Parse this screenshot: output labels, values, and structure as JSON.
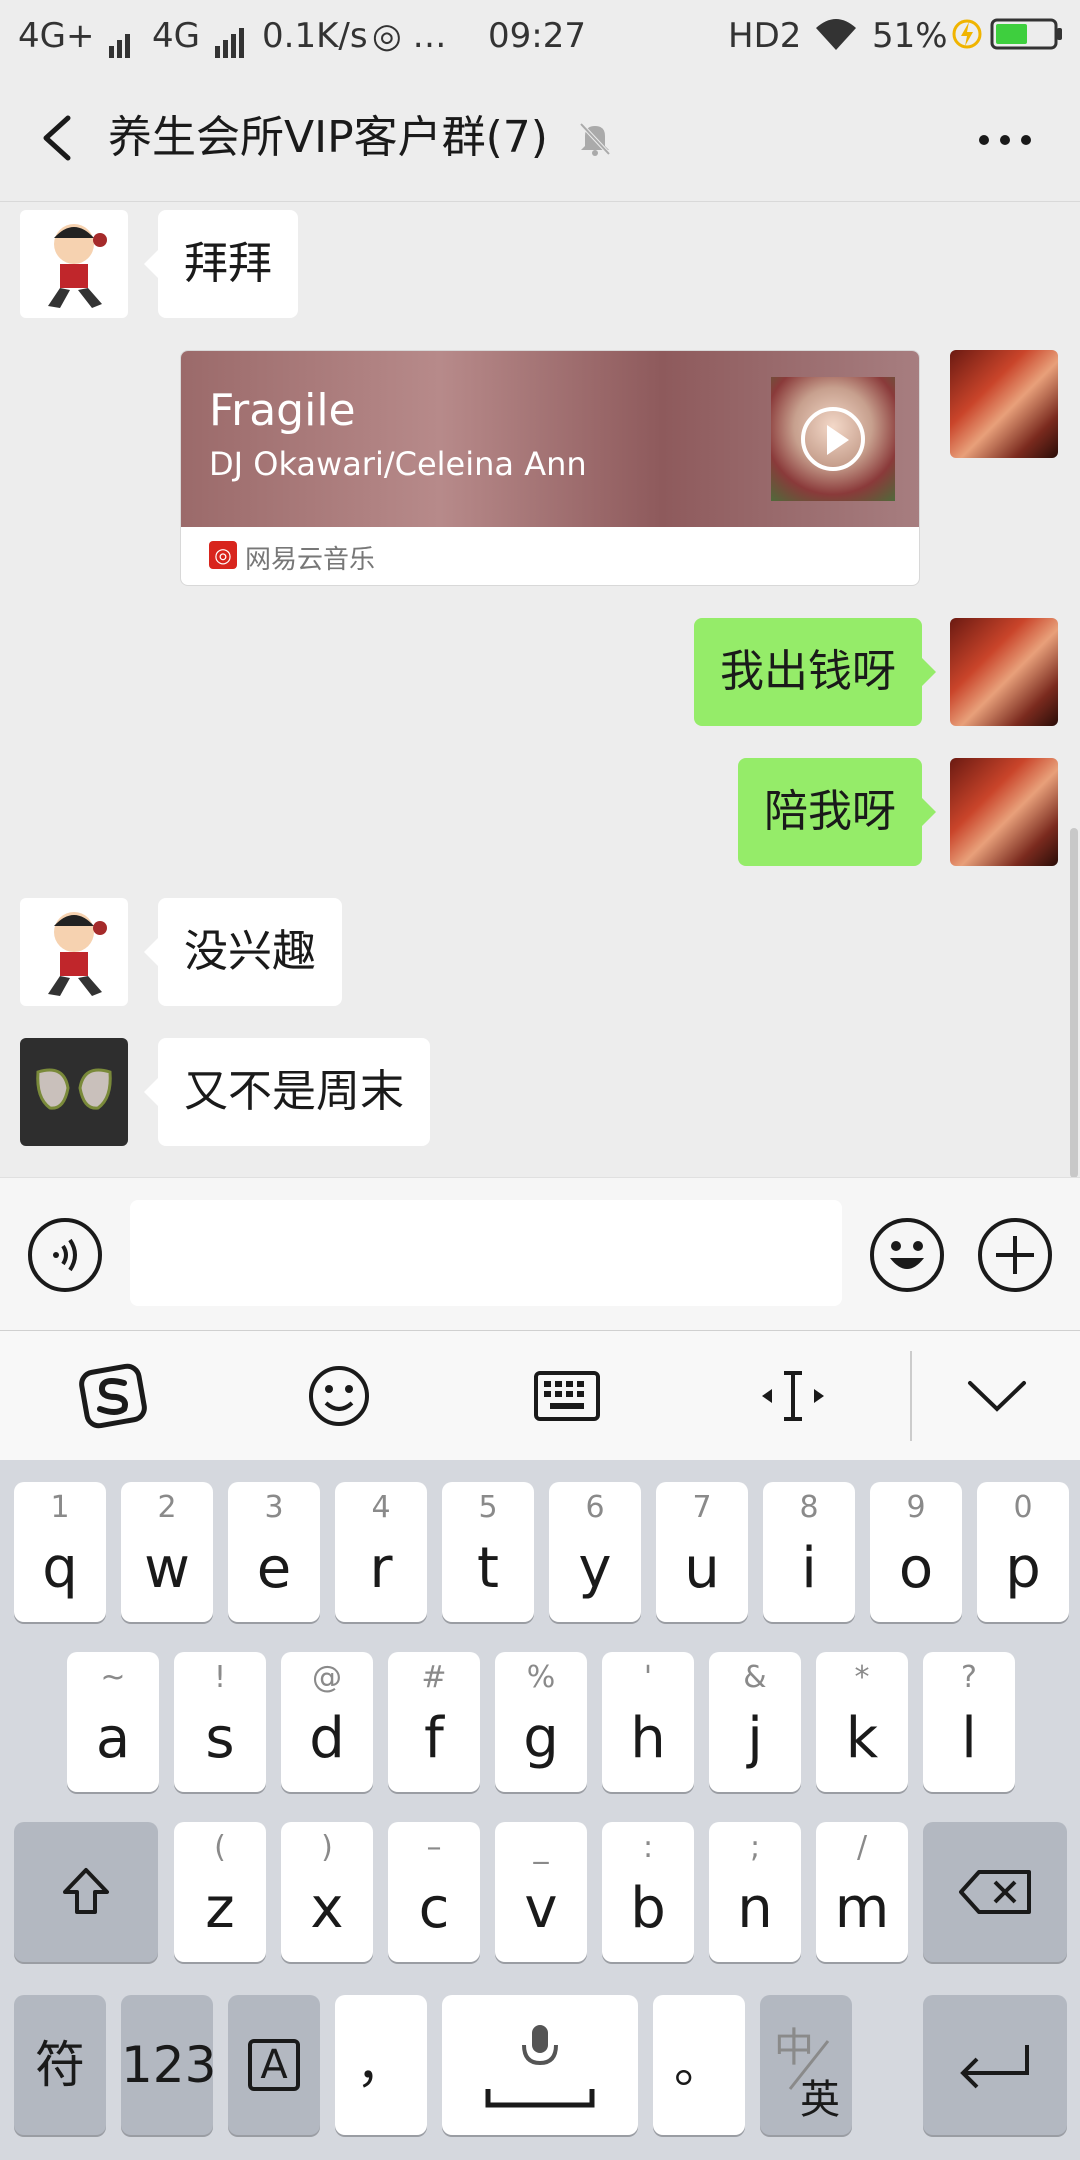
{
  "status_bar": {
    "network1": "4G+",
    "network2": "4G",
    "speed": "0.1K/s",
    "extra": "…",
    "time": "09:27",
    "hd": "HD2",
    "battery": "51%"
  },
  "header": {
    "title": "养生会所VIP客户群(7)"
  },
  "messages": [
    {
      "side": "left",
      "text": "拜拜"
    },
    {
      "side": "right",
      "type": "music",
      "title": "Fragile",
      "artist": "DJ Okawari/Celeina Ann",
      "source": "网易云音乐"
    },
    {
      "side": "right",
      "text": "我出钱呀"
    },
    {
      "side": "right",
      "text": "陪我呀"
    },
    {
      "side": "left",
      "text": "没兴趣"
    },
    {
      "side": "left",
      "text": "又不是周末"
    }
  ],
  "keyboard": {
    "row1": [
      {
        "hint": "1",
        "key": "q"
      },
      {
        "hint": "2",
        "key": "w"
      },
      {
        "hint": "3",
        "key": "e"
      },
      {
        "hint": "4",
        "key": "r"
      },
      {
        "hint": "5",
        "key": "t"
      },
      {
        "hint": "6",
        "key": "y"
      },
      {
        "hint": "7",
        "key": "u"
      },
      {
        "hint": "8",
        "key": "i"
      },
      {
        "hint": "9",
        "key": "o"
      },
      {
        "hint": "0",
        "key": "p"
      }
    ],
    "row2": [
      {
        "hint": "~",
        "key": "a"
      },
      {
        "hint": "!",
        "key": "s"
      },
      {
        "hint": "@",
        "key": "d"
      },
      {
        "hint": "#",
        "key": "f"
      },
      {
        "hint": "%",
        "key": "g"
      },
      {
        "hint": "'",
        "key": "h"
      },
      {
        "hint": "&",
        "key": "j"
      },
      {
        "hint": "*",
        "key": "k"
      },
      {
        "hint": "?",
        "key": "l"
      }
    ],
    "row3": [
      {
        "hint": "(",
        "key": "z"
      },
      {
        "hint": ")",
        "key": "x"
      },
      {
        "hint": "–",
        "key": "c"
      },
      {
        "hint": "_",
        "key": "v"
      },
      {
        "hint": ":",
        "key": "b"
      },
      {
        "hint": ";",
        "key": "n"
      },
      {
        "hint": "/",
        "key": "m"
      }
    ],
    "bottom": {
      "symbols": "符",
      "numbers": "123",
      "caps": "A",
      "comma": "，",
      "period": "。",
      "lang_cn": "中",
      "lang_en": "英"
    }
  }
}
